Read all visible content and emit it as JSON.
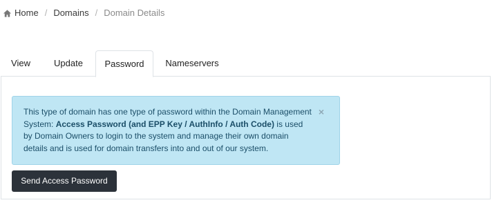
{
  "breadcrumb": {
    "home": "Home",
    "separator": "/",
    "domains": "Domains",
    "current": "Domain Details"
  },
  "tabs": [
    {
      "label": "View",
      "active": false
    },
    {
      "label": "Update",
      "active": false
    },
    {
      "label": "Password",
      "active": true
    },
    {
      "label": "Nameservers",
      "active": false
    }
  ],
  "alert": {
    "text_before": "This type of domain has one type of password within the Domain Management System: ",
    "bold_text": "Access Password (and EPP Key / AuthInfo / Auth Code)",
    "text_after": " is used by Domain Owners to login to the system and manage their own domain details and is used for domain transfers into and out of our system.",
    "close_symbol": "×"
  },
  "send_button": {
    "label": "Send Access Password"
  },
  "colors": {
    "alert_bg": "#bfe6f4",
    "alert_text": "#1b4e68",
    "button_bg": "#2c323a"
  },
  "icons": {
    "home": "home-icon"
  }
}
